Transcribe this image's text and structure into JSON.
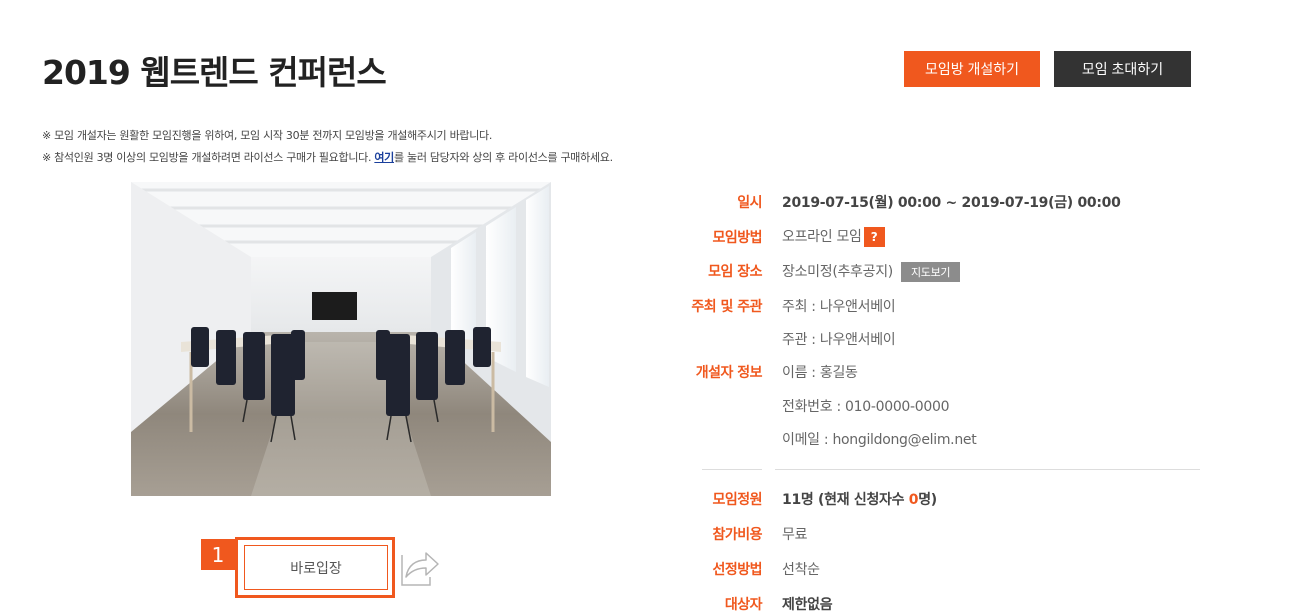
{
  "page": {
    "title": "2019 웹트렌드 컨퍼런스"
  },
  "actions": {
    "open_room": "모임방 개설하기",
    "invite": "모임 초대하기"
  },
  "notices": {
    "line1": "※ 모임 개설자는 원활한 모임진행을 위하여, 모임 시작 30분 전까지 모임방을 개설해주시기 바랍니다.",
    "line2_before": "※ 참석인원 3명 이상의 모임방을 개설하려면 라이선스 구매가 필요합니다. ",
    "line2_link": "여기",
    "line2_after": "를 눌러 담당자와 상의 후 라이선스를 구매하세요."
  },
  "entry": {
    "step_number": "1",
    "enter_label": "바로입장",
    "share_icon": "share-arrow-icon"
  },
  "details": {
    "datetime_label": "일시",
    "datetime_value": "2019-07-15(월) 00:00 ~ 2019-07-19(금) 00:00",
    "method_label": "모임방법",
    "method_value": "오프라인 모임",
    "method_help": "?",
    "place_label": "모임 장소",
    "place_value": "장소미정(추후공지)",
    "place_map": "지도보기",
    "host_label": "주최 및 주관",
    "host_value": "주최 : 나우앤서베이",
    "organizer_value": "주관 : 나우앤서베이",
    "creator_label": "개설자 정보",
    "creator_name": "이름 : 홍길동",
    "creator_phone": "전화번호 : 010-0000-0000",
    "creator_email": "이메일 : hongildong@elim.net",
    "capacity_label": "모임정원",
    "capacity_value_before": "11명 (현재 신청자수 ",
    "capacity_current": "0",
    "capacity_value_after": "명)",
    "fee_label": "참가비용",
    "fee_value": "무료",
    "selection_label": "선정방법",
    "selection_value": "선착순",
    "target_label": "대상자",
    "target_value": "제한없음"
  },
  "colors": {
    "accent": "#f0581e",
    "dark_button": "#333333",
    "map_button": "#8c8c8c",
    "link": "#1a3f9c"
  }
}
